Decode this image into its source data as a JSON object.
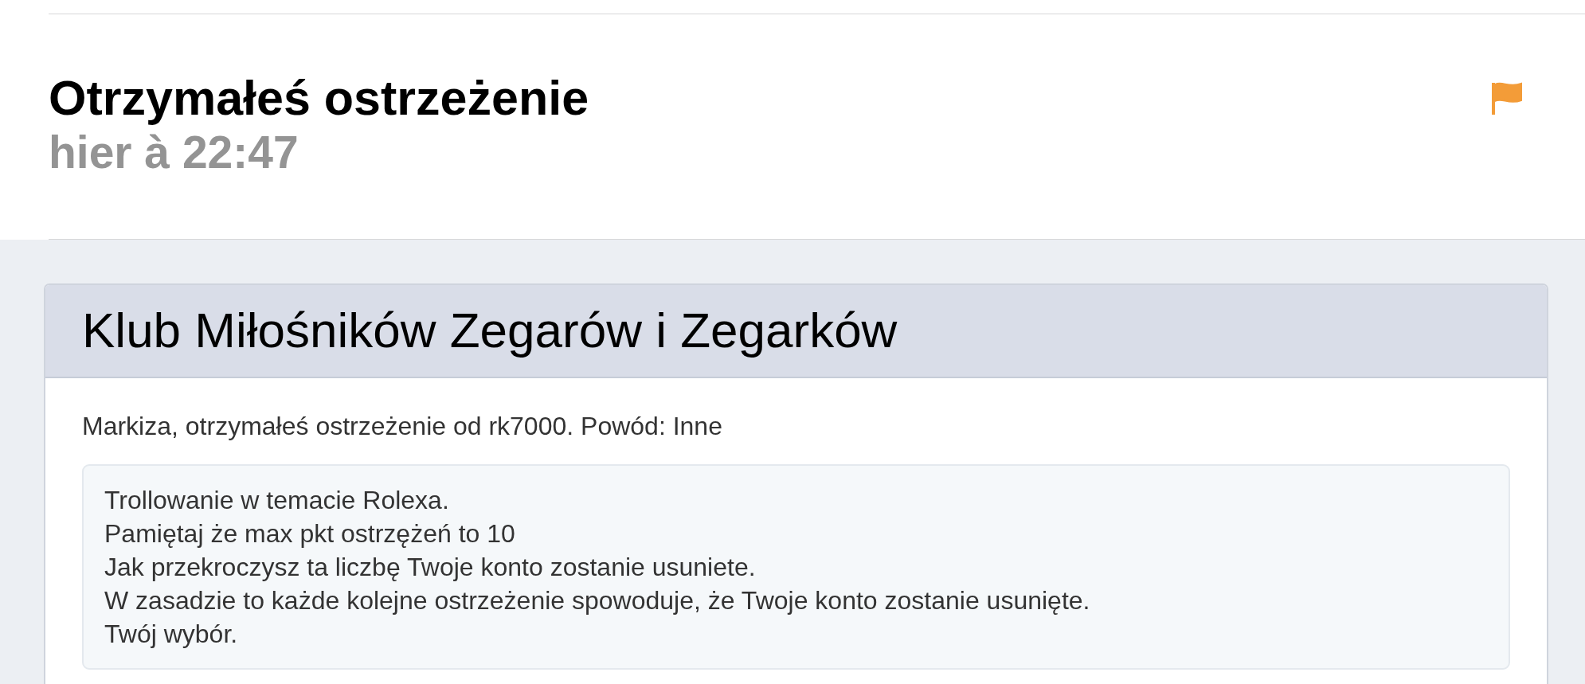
{
  "message": {
    "subject": "Otrzymałeś ostrzeżenie",
    "time": "hier à 22:47",
    "flagged": true
  },
  "card": {
    "forum_name": "Klub Miłośników Zegarów i Zegarków",
    "intro": "Markiza, otrzymałeś ostrzeżenie od rk7000. Powód: Inne",
    "quote_lines": [
      "Trollowanie w temacie Rolexa.",
      "Pamiętaj że max pkt ostrzężeń to 10",
      "Jak przekroczysz ta liczbę Twoje konto zostanie usuniete.",
      "W zasadzie to każde kolejne ostrzeżenie spowoduje, że Twoje konto zostanie usunięte.",
      "Twój wybór."
    ]
  }
}
